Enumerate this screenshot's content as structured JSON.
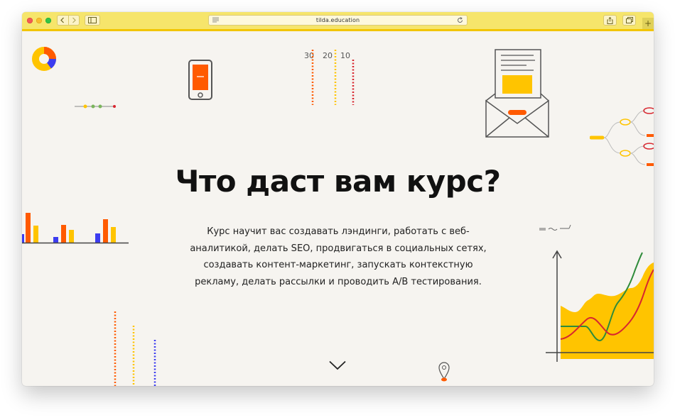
{
  "browser": {
    "url": "tilda.education",
    "icons": {
      "close": "close-dot",
      "minimize": "minimize-dot",
      "maximize": "maximize-dot",
      "back": "chevron-left-icon",
      "forward": "chevron-right-icon",
      "sidebar": "sidebar-icon",
      "reader": "reader-icon",
      "reload": "reload-icon",
      "share": "share-icon",
      "tabs": "tabs-icon",
      "new_tab": "plus-icon"
    },
    "new_tab_symbol": "+",
    "colors": {
      "toolbar": "#f6e56b",
      "accent_line": "#f2c500"
    }
  },
  "page": {
    "heading": "Что даст вам курс?",
    "description": "Курс научит вас создавать лэндинги, работать с веб-аналитикой, делать SEO, продвигаться в социальных сетях, создавать контент-маркетинг, запускать контекстную рекламу, делать рассылки и проводить A/B тестирования.",
    "ruler_labels": [
      "30",
      "20",
      "10"
    ],
    "scroll_icon": "chevron-down-icon",
    "colors": {
      "background": "#f6f4f0",
      "orange": "#ff5a00",
      "yellow": "#ffc400",
      "blue": "#3c3cf0",
      "red": "#d8262f",
      "green": "#2e8b3a"
    }
  }
}
